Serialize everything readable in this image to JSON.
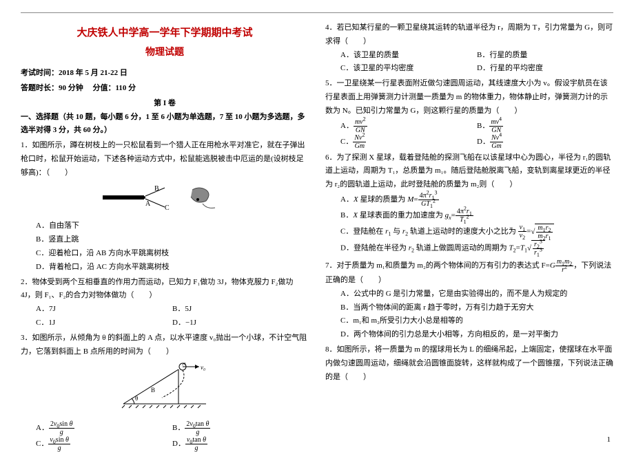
{
  "header": {
    "title_main": "大庆铁人中学高一学年下学期期中考试",
    "title_sub": "物理试题",
    "exam_time_label": "考试时间：",
    "exam_time_value": "2018 年 5 月 21-22 日",
    "duration_label": "答题时长：",
    "duration_value": "90 分钟",
    "score_label": "分值：",
    "score_value": "110 分",
    "part_label": "第 I 卷",
    "section1": "一、选择题（共 10 题，每小题 6 分，1 至 6 小题为单选题，7 至 10 小题为多选题，多选半对得 3 分，共 60 分。）"
  },
  "q1": {
    "text": "1．如图所示，蹲在树枝上的一只松鼠看到一个猎人正在用枪水平对准它，就在子弹出枪口时，松鼠开始运动，下述各种运动方式中，松鼠能逃脱被击中厄运的是(设树枝足够高)：（　　）",
    "optA": "A．自由落下",
    "optB": "B．竖直上跳",
    "optC": "C．迎着枪口，沿 AB 方向水平跳离树枝",
    "optD": "D．背着枪口，沿 AC 方向水平跳离树枝"
  },
  "q2": {
    "text": "2．物体受到两个互相垂直的作用力而运动，已知力 F₁做功 3J，物体克服力 F₂做功 4J，则 F₁、F₂的合力对物体做功（　　）",
    "optA": "A．7J",
    "optB": "B．5J",
    "optC": "C．1J",
    "optD": "D．−1J"
  },
  "q3": {
    "text": "3．如图所示，从倾角为 θ 的斜面上的 A 点，以水平速度 v₀抛出一个小球，不计空气阻力，它落到斜面上 B 点所用的时间为（　　）"
  },
  "q4": {
    "text": "4．若已知某行星的一颗卫星绕其运转的轨道半径为 r，周期为 T，引力常量为 G，则可求得（　　）",
    "optA": "A．该卫星的质量",
    "optB": "B．行星的质量",
    "optC": "C．该卫星的平均密度",
    "optD": "D．行星的平均密度"
  },
  "q5": {
    "text": "5．一卫星绕某一行星表面附近做匀速圆周运动，其线速度大小为 v。假设宇航员在该行星表面上用弹簧测力计测量一质量为 m 的物体重力，物体静止时，弹簧测力计的示数为 N。已知引力常量为 G，则这颗行星的质量为（　　）"
  },
  "q6": {
    "text": "6．为了探测 X 星球，载着登陆舱的探测飞船在以该星球中心为圆心，半径为 r₁的圆轨道上运动，周期为 T₁，总质量为 m₁。随后登陆舱脱离飞船，变轨到离星球更近的半径为 r₂的圆轨道上运动，此时登陆舱的质量为 m₂则（　　）"
  },
  "q7": {
    "text": "7．对于质量为 m₁和质量为 m₂的两个物体间的万有引力的表达式 F=",
    "text_tail": "，下列说法正确的是（　　）",
    "optA": "A．公式中的 G 是引力常量，它是由实验得出的，而不是人为规定的",
    "optB": "B．当两个物体间的距离 r 趋于零时，万有引力趋于无穷大",
    "optC": "C．m₁和 m₂所受引力大小总是相等的",
    "optD": "D．两个物体间的引力总是大小相等，方向相反的，是一对平衡力"
  },
  "q8": {
    "text": "8．如图所示，将一质量为 m 的摆球用长为 L 的细绳吊起，上端固定，使摆球在水平面内做匀速圆周运动，细绳就会沿圆锥面旋转，这样就构成了一个圆锥摆，下列说法正确的是（　　）"
  },
  "page_number": "1"
}
